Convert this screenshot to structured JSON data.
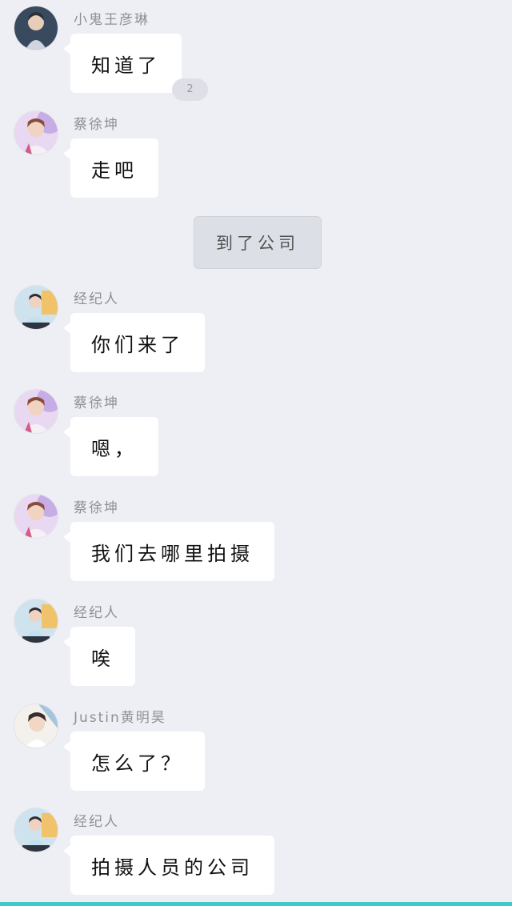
{
  "badge": {
    "count": "2"
  },
  "narration": {
    "text": "到了公司"
  },
  "messages": [
    {
      "sender": "小鬼王彦琳",
      "text": "知道了",
      "avatar": "avatar-wang-yanlin"
    },
    {
      "sender": "蔡徐坤",
      "text": "走吧",
      "avatar": "avatar-cai-xukun"
    },
    {
      "sender": "经纪人",
      "text": "你们来了",
      "avatar": "avatar-manager"
    },
    {
      "sender": "蔡徐坤",
      "text": "嗯，",
      "avatar": "avatar-cai-xukun"
    },
    {
      "sender": "蔡徐坤",
      "text": "我们去哪里拍摄",
      "avatar": "avatar-cai-xukun"
    },
    {
      "sender": "经纪人",
      "text": "唉",
      "avatar": "avatar-manager"
    },
    {
      "sender": "Justin黄明昊",
      "text": "怎么了？",
      "avatar": "avatar-justin"
    },
    {
      "sender": "经纪人",
      "text": "拍摄人员的公司",
      "avatar": "avatar-manager"
    }
  ],
  "colors": {
    "background": "#eeeff4",
    "bubble": "#ffffff",
    "narration": "#dcdfe6",
    "accent_bar": "#3fc9c9"
  }
}
